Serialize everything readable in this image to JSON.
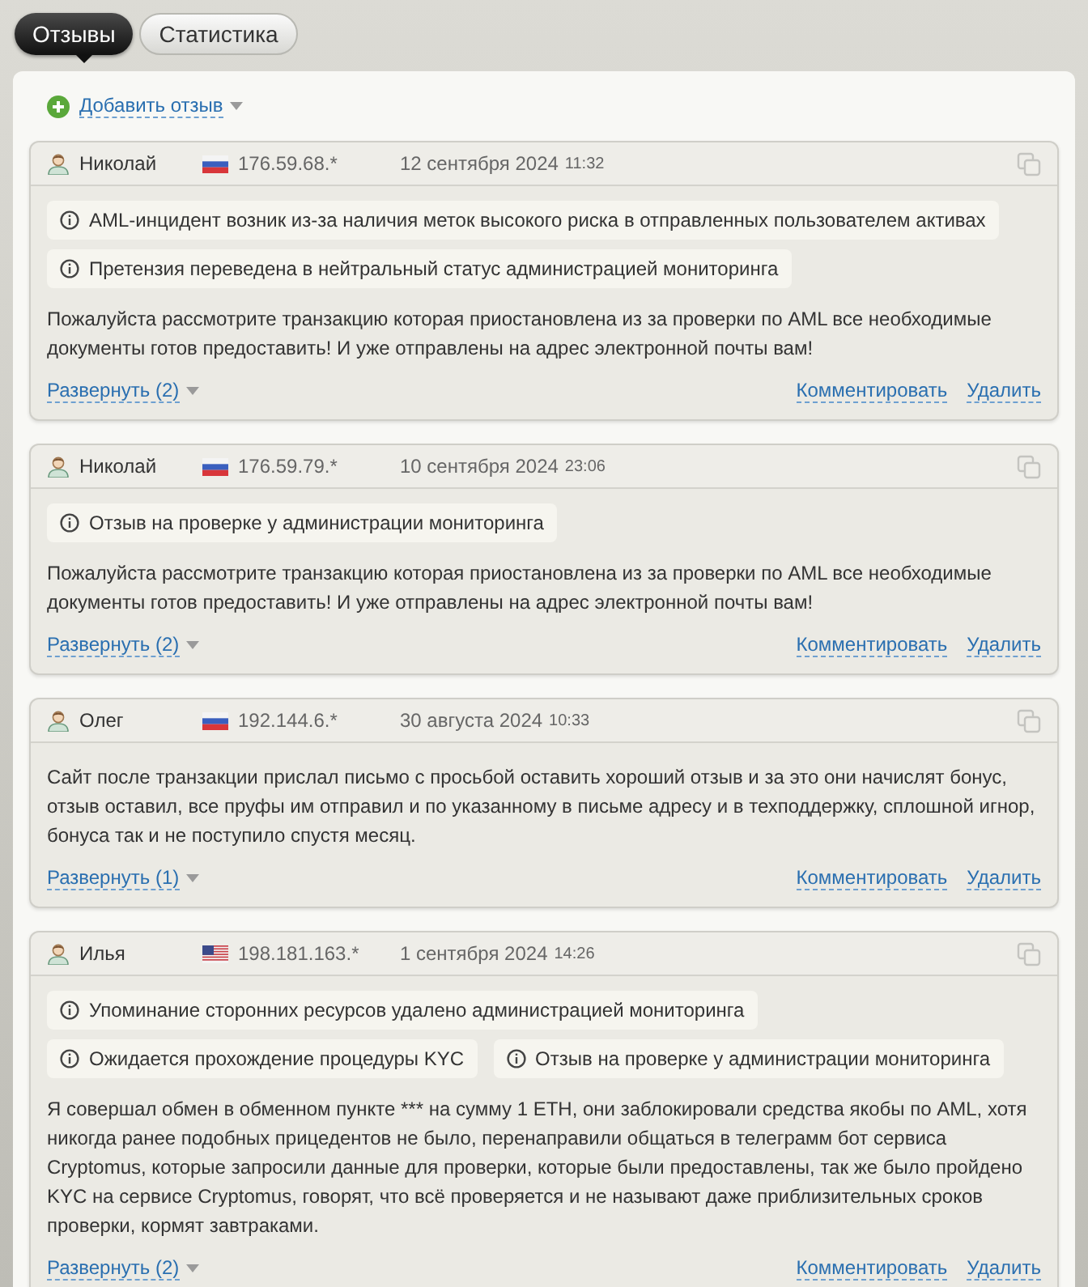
{
  "tabs": [
    {
      "label": "Отзывы",
      "selected": true
    },
    {
      "label": "Статистика",
      "selected": false
    }
  ],
  "add_review": {
    "label": "Добавить отзыв"
  },
  "reviews": [
    {
      "author": "Николай",
      "flag": {
        "kind": "ru"
      },
      "ip": "176.59.68.*",
      "date": "12 сентября 2024",
      "time": "11:32",
      "notice_rows": [
        [
          "AML-инцидент возник из-за наличия меток высокого риска в отправленных пользователем активах"
        ],
        [
          "Претензия переведена в нейтральный статус администрацией мониторинга"
        ]
      ],
      "text": "Пожалуйста рассмотрите транзакцию которая приостановлена из за проверки по AML все необходимые документы готов предоставить! И уже отправлены на адрес электронной почты вам!",
      "expand": "Развернуть (2)",
      "comment": "Комментировать",
      "delete": "Удалить"
    },
    {
      "author": "Николай",
      "flag": {
        "kind": "ru"
      },
      "ip": "176.59.79.*",
      "date": "10 сентября 2024",
      "time": "23:06",
      "notice_rows": [
        [
          "Отзыв на проверке у администрации мониторинга"
        ]
      ],
      "text": "Пожалуйста рассмотрите транзакцию которая приостановлена из за проверки по AML все необходимые документы готов предоставить! И уже отправлены на адрес электронной почты вам!",
      "expand": "Развернуть (2)",
      "comment": "Комментировать",
      "delete": "Удалить"
    },
    {
      "author": "Олег",
      "flag": {
        "kind": "ru"
      },
      "ip": "192.144.6.*",
      "date": "30 августа 2024",
      "time": "10:33",
      "text": "Сайт после транзакции прислал письмо с просьбой оставить хороший отзыв и за это они начислят бонус, отзыв оставил, все пруфы им отправил и по указанному в письме адресу и в техподдержку, сплошной игнор, бонуса так и не поступило спустя месяц.",
      "expand": "Развернуть (1)",
      "comment": "Комментировать",
      "delete": "Удалить"
    },
    {
      "author": "Илья",
      "flag": {
        "kind": "us"
      },
      "ip": "198.181.163.*",
      "date": "1 сентября 2024",
      "time": "14:26",
      "notice_rows": [
        [
          "Упоминание сторонних ресурсов удалено администрацией мониторинга"
        ],
        [
          "Ожидается прохождение процедуры KYC",
          "Отзыв на проверке у администрации мониторинга"
        ]
      ],
      "text": "Я совершал обмен в обменном пункте *** на сумму 1 ETH, они заблокировали средства якобы по AML, хотя никогда ранее подобных прицедентов не было, перенаправили общаться в телеграмм бот сервиса Cryptomus, которые запросили данные для проверки, которые были предоставлены, так же было пройдено KYC на сервисе Cryptomus, говорят, что всё проверяется и не называют даже приблизительных сроков проверки, кормят завтраками.",
      "expand": "Развернуть (2)",
      "comment": "Комментировать",
      "delete": "Удалить"
    }
  ]
}
